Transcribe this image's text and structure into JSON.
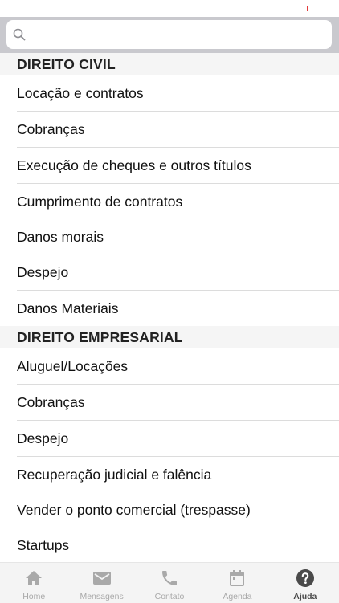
{
  "search": {
    "placeholder": "",
    "value": ""
  },
  "sections": [
    {
      "title": "DIREITO CIVIL",
      "items": [
        "Locação e contratos",
        "Cobranças",
        "Execução de cheques e outros títulos",
        "Cumprimento de contratos",
        "Danos morais",
        "Despejo",
        "Danos Materiais"
      ]
    },
    {
      "title": "DIREITO EMPRESARIAL",
      "items": [
        "Aluguel/Locações",
        "Cobranças",
        "Despejo",
        "Recuperação judicial e falência",
        "Vender o ponto comercial (trespasse)",
        "Startups"
      ]
    }
  ],
  "tab_bar": {
    "tabs": [
      {
        "label": "Home",
        "icon": "home-icon",
        "active": false
      },
      {
        "label": "Mensagens",
        "icon": "mail-icon",
        "active": false
      },
      {
        "label": "Contato",
        "icon": "phone-icon",
        "active": false
      },
      {
        "label": "Agenda",
        "icon": "calendar-icon",
        "active": false
      },
      {
        "label": "Ajuda",
        "icon": "help-icon",
        "active": true
      }
    ]
  },
  "colors": {
    "search_background": "#c9c9ce",
    "section_header_background": "#f5f5f5",
    "tab_inactive": "#a9a9a9",
    "tab_active": "#4a4a4a"
  }
}
